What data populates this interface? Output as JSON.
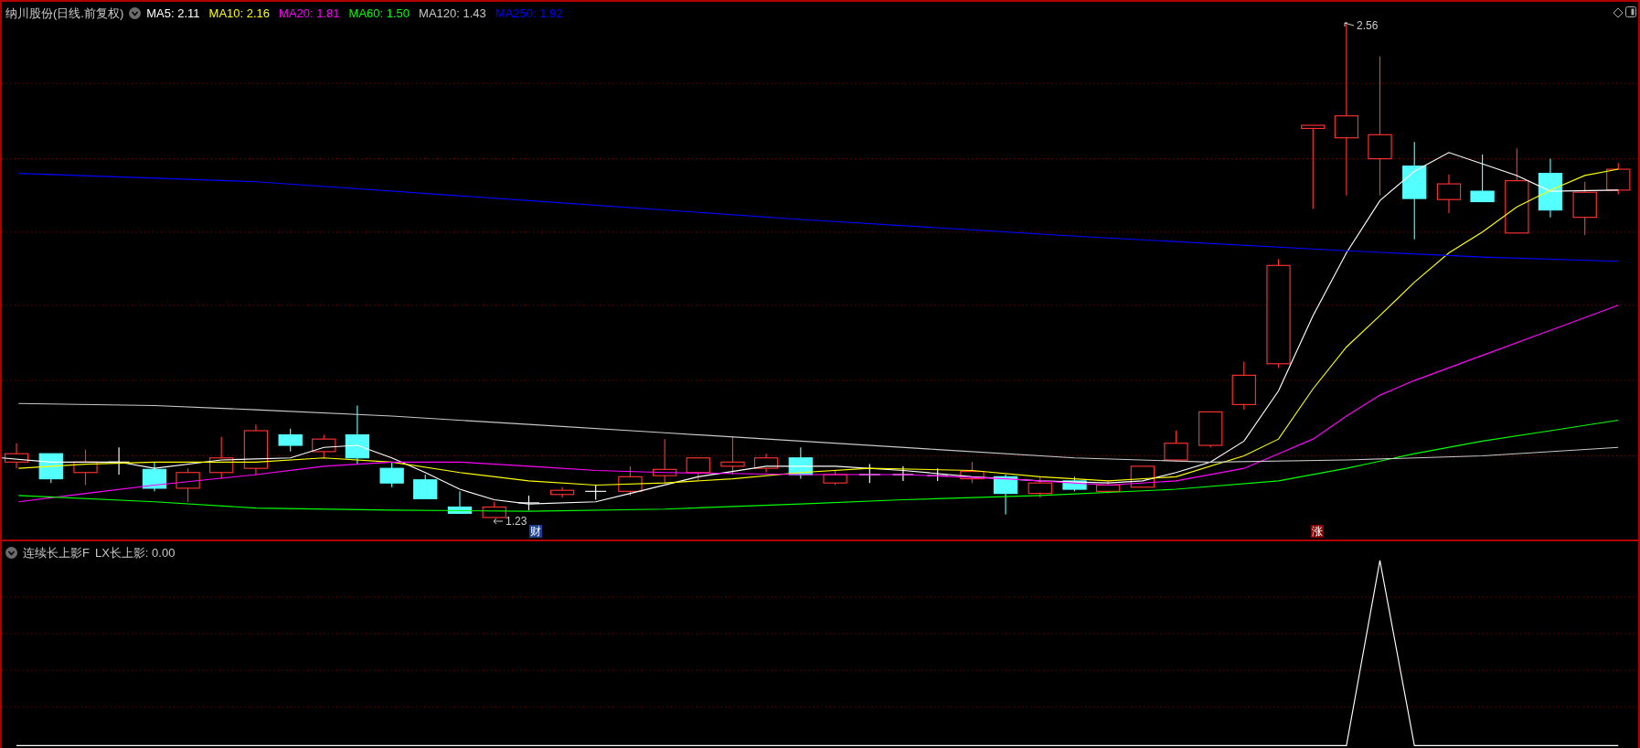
{
  "chart": {
    "title": "纳川股份(日线.前复权)",
    "moving_averages": [
      {
        "label": "MA5: 2.11",
        "color": "#ffffff"
      },
      {
        "label": "MA10: 2.16",
        "color": "#ffff00"
      },
      {
        "label": "MA20: 1.81",
        "color": "#ff00ff"
      },
      {
        "label": "MA60: 1.50",
        "color": "#00ff00"
      },
      {
        "label": "MA120: 1.43",
        "color": "#c8c8c8"
      },
      {
        "label": "MA250: 1.92",
        "color": "#0000ff"
      }
    ],
    "high_label": "2.56",
    "low_label": "1.23",
    "event_markers": [
      {
        "label": "财",
        "kind": "finance"
      },
      {
        "label": "涨",
        "kind": "limit_up"
      }
    ]
  },
  "indicator": {
    "name": "连续长上影F",
    "reading": "LX长上影: 0.00"
  }
}
